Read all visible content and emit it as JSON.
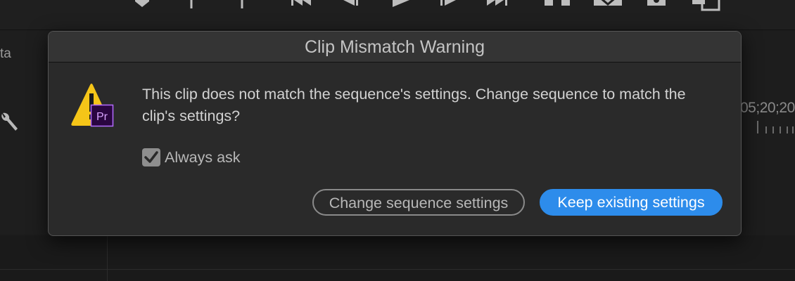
{
  "dialog": {
    "title": "Clip Mismatch Warning",
    "message": "This clip does not match the sequence's settings. Change sequence to match the clip's settings?",
    "always_ask_label": "Always ask",
    "always_ask_checked": true,
    "change_button_label": "Change sequence settings",
    "keep_button_label": "Keep existing settings"
  },
  "background": {
    "left_panel_fragment": "ta",
    "timecode_fragment": "05;20;20"
  },
  "icons": {
    "warning": "warning-triangle-icon",
    "app_badge": "premiere-pro-icon",
    "badge_text": "Pr"
  },
  "colors": {
    "primary_button": "#2d8ceb",
    "warning_yellow": "#f5c518",
    "badge_purple": "#2a0640",
    "badge_text": "#d9a3ff"
  }
}
